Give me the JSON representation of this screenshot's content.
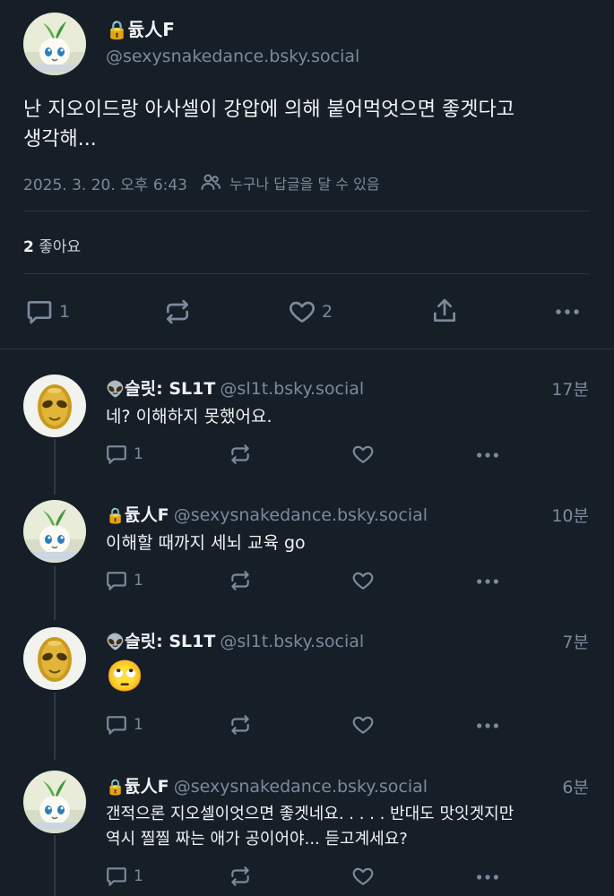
{
  "main_post": {
    "author_name": "🔒듌人F",
    "handle": "@sexysnakedance.bsky.social",
    "text_line1": "난 지오이드랑 아사셀이 강압에 의해 붙어먹엇으면 좋겟다고",
    "text_line2": "생각해...",
    "timestamp": "2025. 3. 20. 오후 6:43",
    "reply_setting": "누구나 답글을 달 수 있음",
    "likes_count": "2",
    "likes_label": "좋아요",
    "reply_count": "1",
    "like_count_action": "2"
  },
  "replies": [
    {
      "emoji": "👽",
      "name": "슬릿: SL1T",
      "handle": "@sl1t.bsky.social",
      "time": "17분",
      "text": "네? 이해하지 못했어요.",
      "reply_count": "1"
    },
    {
      "emoji": "🔒",
      "name": "듌人F",
      "handle": "@sexysnakedance.bsky.social",
      "time": "10분",
      "text": "이해할 때까지 세뇌 교육 go",
      "reply_count": "1"
    },
    {
      "emoji": "👽",
      "name": "슬릿: SL1T",
      "handle": "@sl1t.bsky.social",
      "time": "7분",
      "text": "🙄",
      "reply_count": "1"
    },
    {
      "emoji": "🔒",
      "name": "듌人F",
      "handle": "@sexysnakedance.bsky.social",
      "time": "6분",
      "text_line1": "갠적으론 지오셀이엇으면 좋겟네요. . . . . 반대도 맛잇겟지만",
      "text_line2": "역시 찔찔 짜는 애가 공이어야... 듣고계세요?",
      "reply_count": "1"
    }
  ],
  "icons": {
    "reply": "speech-bubble-icon",
    "repost": "repost-arrows-icon",
    "like": "heart-icon",
    "share": "share-upload-icon",
    "more": "more-dots-icon",
    "audience": "people-icon"
  },
  "colors": {
    "background": "#161e27",
    "text": "#f1f3f5",
    "muted": "#7b8a9c",
    "divider": "#2a3542"
  }
}
